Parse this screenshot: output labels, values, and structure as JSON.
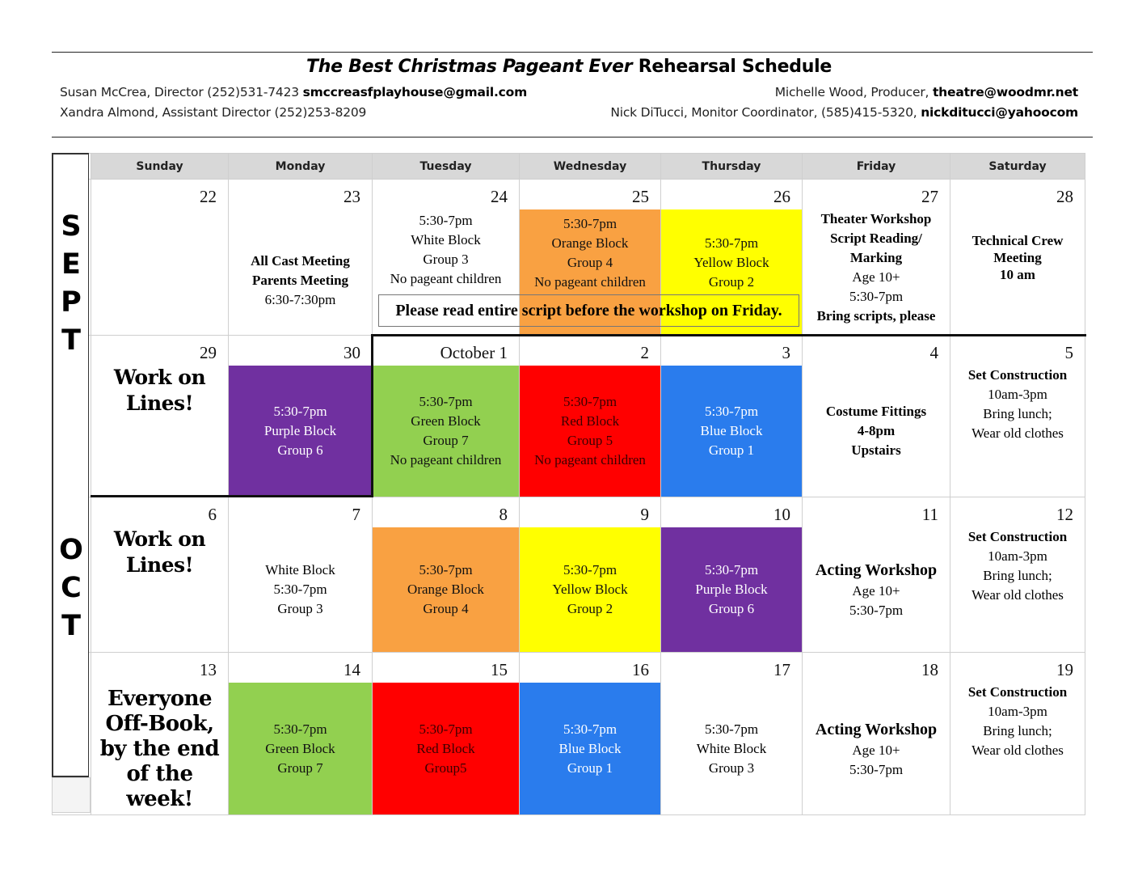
{
  "header": {
    "title_italic": "The Best Christmas Pageant Ever",
    "title_rest": " Rehearsal Schedule",
    "contacts": {
      "director": {
        "text": "Susan McCrea, Director (252)531-7423 ",
        "email": "smccreasfplayhouse@gmail.com"
      },
      "assistant_director": {
        "text": "Xandra Almond, Assistant Director  (252)253-8209"
      },
      "producer": {
        "text": "Michelle Wood, Producer, ",
        "email": "theatre@woodmr.net"
      },
      "monitor_coordinator": {
        "text": "Nick DiTucci, Monitor Coordinator, (585)415-5320, ",
        "email": "nickditucci@yahoocom"
      }
    }
  },
  "side_labels": {
    "sept": [
      "S",
      "E",
      "P",
      "T"
    ],
    "oct": [
      "O",
      "C",
      "T"
    ]
  },
  "weekdays": [
    "Sunday",
    "Monday",
    "Tuesday",
    "Wednesday",
    "Thursday",
    "Friday",
    "Saturday"
  ],
  "colors": {
    "orange": "#f9a142",
    "yellow": "#ffff00",
    "purple": "#7030a0",
    "green": "#92d050",
    "red": "#ff0000",
    "blue": "#2a7ced",
    "header_gray": "#d8d8d8"
  },
  "note": "Please read entire script before the workshop on Friday.",
  "weeks": [
    {
      "days": [
        {
          "date": "22",
          "lines": []
        },
        {
          "date": "23",
          "lines": [
            {
              "t": "All Cast Meeting",
              "b": true
            },
            {
              "t": "Parents Meeting",
              "b": true
            },
            {
              "t": "6:30-7:30pm"
            }
          ]
        },
        {
          "date": "24",
          "lines": [
            {
              "t": "5:30-7pm"
            },
            {
              "t": "White Block"
            },
            {
              "t": "Group 3"
            },
            {
              "t": "No pageant children"
            }
          ]
        },
        {
          "date": "25",
          "color": "orange",
          "lines": [
            {
              "t": "5:30-7pm"
            },
            {
              "t": "Orange Block"
            },
            {
              "t": "Group 4"
            },
            {
              "t": "No pageant children"
            }
          ]
        },
        {
          "date": "26",
          "color": "yellow",
          "lines": [
            {
              "t": "5:30-7pm"
            },
            {
              "t": "Yellow Block"
            },
            {
              "t": "Group 2"
            }
          ]
        },
        {
          "date": "27",
          "lines": [
            {
              "t": "Theater Workshop",
              "b": true
            },
            {
              "t": "Script Reading/",
              "b": true
            },
            {
              "t": "Marking",
              "b": true
            },
            {
              "t": "Age 10+"
            },
            {
              "t": "5:30-7pm"
            },
            {
              "t": "Bring scripts, please",
              "b": true
            }
          ]
        },
        {
          "date": "28",
          "lines": [
            {
              "t": "Technical Crew",
              "b": true
            },
            {
              "t": "Meeting",
              "b": true
            },
            {
              "t": "10 am",
              "b": true
            }
          ]
        }
      ]
    },
    {
      "days": [
        {
          "date": "29",
          "fun": "Work on Lines!"
        },
        {
          "date": "30",
          "color": "purple",
          "lines": [
            {
              "t": "5:30-7pm"
            },
            {
              "t": "Purple Block"
            },
            {
              "t": "Group 6"
            }
          ]
        },
        {
          "date": "October 1",
          "color": "green",
          "lines": [
            {
              "t": "5:30-7pm"
            },
            {
              "t": "Green Block"
            },
            {
              "t": "Group 7"
            },
            {
              "t": "No pageant children"
            }
          ]
        },
        {
          "date": "2",
          "color": "red",
          "lines": [
            {
              "t": "5:30-7pm"
            },
            {
              "t": "Red Block"
            },
            {
              "t": "Group 5"
            },
            {
              "t": "No pageant children"
            }
          ]
        },
        {
          "date": "3",
          "color": "blue",
          "lines": [
            {
              "t": "5:30-7pm"
            },
            {
              "t": "Blue Block"
            },
            {
              "t": "Group 1"
            }
          ]
        },
        {
          "date": "4",
          "lines": [
            {
              "t": "Costume Fittings",
              "b": true
            },
            {
              "t": "4-8pm",
              "b": true
            },
            {
              "t": "Upstairs",
              "b": true
            }
          ]
        },
        {
          "date": "5",
          "lines": [
            {
              "t": "Set Construction",
              "b": true
            },
            {
              "t": "10am-3pm"
            },
            {
              "t": "Bring lunch;"
            },
            {
              "t": "Wear old clothes"
            }
          ]
        }
      ]
    },
    {
      "days": [
        {
          "date": "6",
          "fun": "Work on Lines!"
        },
        {
          "date": "7",
          "lines": [
            {
              "t": "White Block"
            },
            {
              "t": "5:30-7pm"
            },
            {
              "t": "Group 3"
            }
          ]
        },
        {
          "date": "8",
          "color": "orange",
          "lines": [
            {
              "t": "5:30-7pm"
            },
            {
              "t": "Orange Block"
            },
            {
              "t": "Group 4"
            }
          ]
        },
        {
          "date": "9",
          "color": "yellow",
          "lines": [
            {
              "t": "5:30-7pm"
            },
            {
              "t": "Yellow Block"
            },
            {
              "t": "Group 2"
            }
          ]
        },
        {
          "date": "10",
          "color": "purple",
          "lines": [
            {
              "t": "5:30-7pm"
            },
            {
              "t": "Purple Block"
            },
            {
              "t": "Group 6"
            }
          ]
        },
        {
          "date": "11",
          "lines": [
            {
              "t": "Acting Workshop",
              "big": true
            },
            {
              "t": "Age 10+"
            },
            {
              "t": "5:30-7pm"
            }
          ]
        },
        {
          "date": "12",
          "lines": [
            {
              "t": "Set Construction",
              "b": true
            },
            {
              "t": "10am-3pm"
            },
            {
              "t": "Bring lunch;"
            },
            {
              "t": "Wear old clothes"
            }
          ]
        }
      ]
    },
    {
      "days": [
        {
          "date": "13",
          "fun": "Everyone Off-Book, by the end of the week!"
        },
        {
          "date": "14",
          "color": "green",
          "lines": [
            {
              "t": "5:30-7pm"
            },
            {
              "t": "Green Block"
            },
            {
              "t": "Group 7"
            }
          ]
        },
        {
          "date": "15",
          "color": "red",
          "lines": [
            {
              "t": "5:30-7pm"
            },
            {
              "t": "Red Block"
            },
            {
              "t": "Group5"
            }
          ]
        },
        {
          "date": "16",
          "color": "blue",
          "lines": [
            {
              "t": "5:30-7pm"
            },
            {
              "t": "Blue Block"
            },
            {
              "t": "Group 1"
            }
          ]
        },
        {
          "date": "17",
          "lines": [
            {
              "t": "5:30-7pm"
            },
            {
              "t": "White Block"
            },
            {
              "t": "Group 3"
            }
          ]
        },
        {
          "date": "18",
          "lines": [
            {
              "t": "Acting Workshop",
              "big": true
            },
            {
              "t": "Age 10+"
            },
            {
              "t": "5:30-7pm"
            }
          ]
        },
        {
          "date": "19",
          "lines": [
            {
              "t": "Set Construction",
              "b": true
            },
            {
              "t": "10am-3pm"
            },
            {
              "t": "Bring lunch;"
            },
            {
              "t": "Wear old clothes"
            }
          ]
        }
      ]
    }
  ]
}
